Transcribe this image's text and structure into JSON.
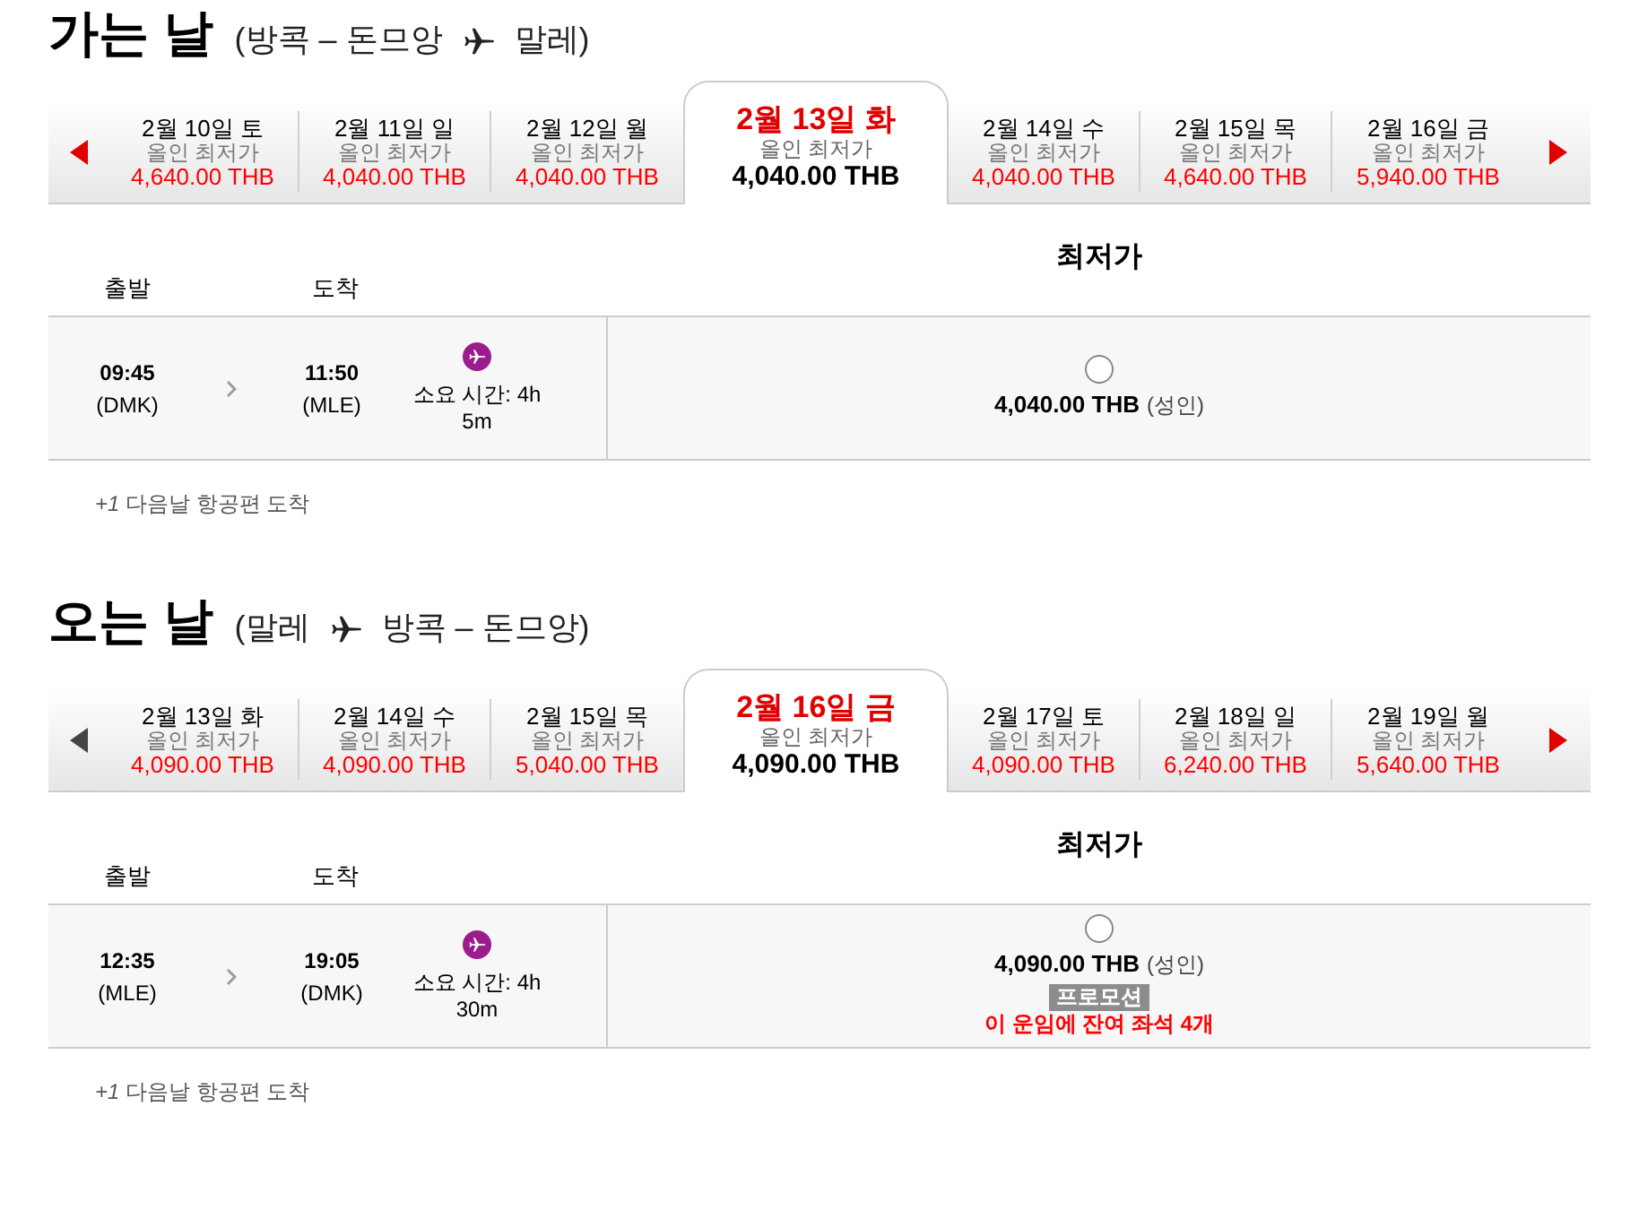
{
  "sections": [
    {
      "title": "가는 날",
      "route_from": "(방콕 – 돈므앙",
      "route_to": "말레)",
      "prev_enabled": true,
      "next_enabled": true,
      "dates": [
        {
          "date": "2월 10일 토",
          "label": "올인 최저가",
          "price": "4,640.00 THB",
          "selected": false
        },
        {
          "date": "2월 11일 일",
          "label": "올인 최저가",
          "price": "4,040.00 THB",
          "selected": false
        },
        {
          "date": "2월 12일 월",
          "label": "올인 최저가",
          "price": "4,040.00 THB",
          "selected": false
        },
        {
          "date": "2월 13일 화",
          "label": "올인 최저가",
          "price": "4,040.00 THB",
          "selected": true
        },
        {
          "date": "2월 14일 수",
          "label": "올인 최저가",
          "price": "4,040.00 THB",
          "selected": false
        },
        {
          "date": "2월 15일 목",
          "label": "올인 최저가",
          "price": "4,640.00 THB",
          "selected": false
        },
        {
          "date": "2월 16일 금",
          "label": "올인 최저가",
          "price": "5,940.00 THB",
          "selected": false
        }
      ],
      "fare_header": "최저가",
      "depart_header": "출발",
      "arrive_header": "도착",
      "flights": [
        {
          "depart_time": "09:45",
          "depart_airport": "(DMK)",
          "arrive_time": "11:50",
          "arrive_airport": "(MLE)",
          "duration": "소요 시간: 4h 5m",
          "price": "4,040.00 THB",
          "price_note": "(성인)",
          "selected": false
        }
      ],
      "note": "*+1* 다음날 항공편 도착"
    },
    {
      "title": "오는 날",
      "route_from": "(말레",
      "route_to": "방콕 – 돈므앙)",
      "prev_enabled": false,
      "next_enabled": true,
      "dates": [
        {
          "date": "2월 13일 화",
          "label": "올인 최저가",
          "price": "4,090.00 THB",
          "selected": false
        },
        {
          "date": "2월 14일 수",
          "label": "올인 최저가",
          "price": "4,090.00 THB",
          "selected": false
        },
        {
          "date": "2월 15일 목",
          "label": "올인 최저가",
          "price": "5,040.00 THB",
          "selected": false
        },
        {
          "date": "2월 16일 금",
          "label": "올인 최저가",
          "price": "4,090.00 THB",
          "selected": true
        },
        {
          "date": "2월 17일 토",
          "label": "올인 최저가",
          "price": "4,090.00 THB",
          "selected": false
        },
        {
          "date": "2월 18일 일",
          "label": "올인 최저가",
          "price": "6,240.00 THB",
          "selected": false
        },
        {
          "date": "2월 19일 월",
          "label": "올인 최저가",
          "price": "5,640.00 THB",
          "selected": false
        }
      ],
      "fare_header": "최저가",
      "depart_header": "출발",
      "arrive_header": "도착",
      "flights": [
        {
          "depart_time": "12:35",
          "depart_airport": "(MLE)",
          "arrive_time": "19:05",
          "arrive_airport": "(DMK)",
          "duration": "소요 시간: 4h 30m",
          "price": "4,090.00 THB",
          "price_note": "(성인)",
          "selected": false,
          "promo": "프로모션",
          "seats": "이 운임에 잔여 좌석 4개"
        }
      ],
      "note": "*+1* 다음날 항공편 도착"
    }
  ]
}
